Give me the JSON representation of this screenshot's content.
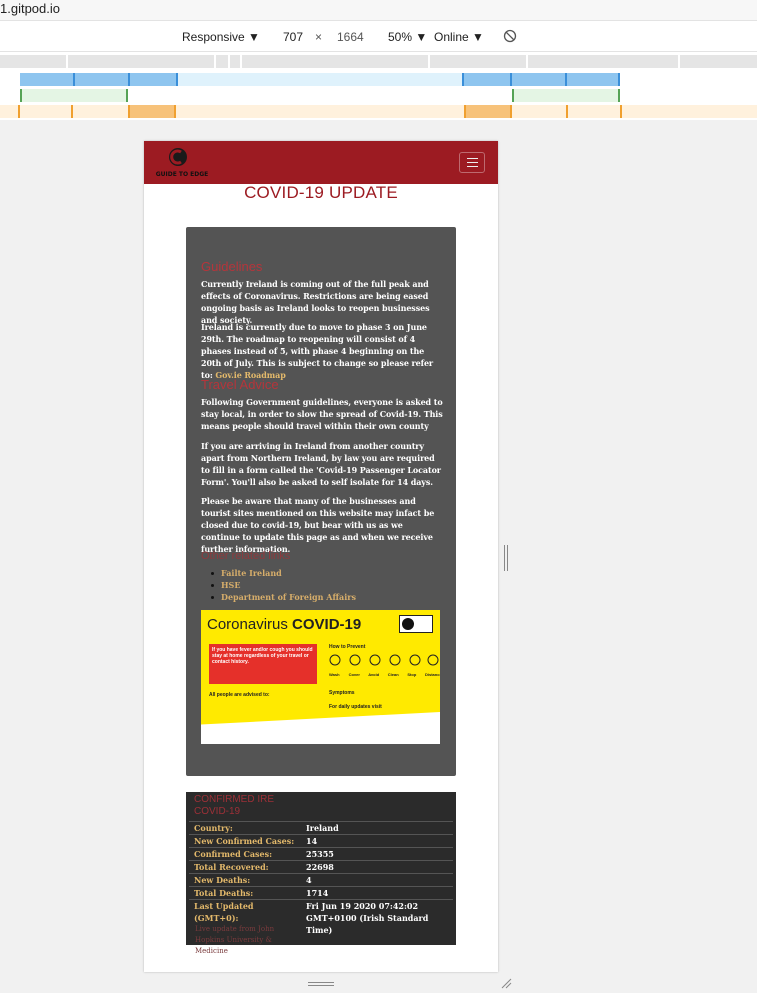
{
  "browser": {
    "url_partial": "1.gitpod.io"
  },
  "devtools": {
    "device": "Responsive",
    "width": "707",
    "times": "×",
    "height": "1664",
    "zoom": "50%",
    "network": "Online"
  },
  "site": {
    "logo_text": "GUIDE TO EDGE",
    "page_title": "COVID-19 UPDATE"
  },
  "guidelines": {
    "heading": "Guidelines",
    "p1": "Currently Ireland is coming out of the full peak and effects of Coronavirus. Restrictions are being eased ongoing basis as Ireland looks to reopen businesses and society.",
    "p2_text": "Ireland is currently due to move to phase 3 on June 29th. The roadmap to reopening will consist of 4 phases instead of 5, with phase 4 beginning on the 20th of July. This is subject to change so please refer to: ",
    "p2_link": "Gov.ie Roadmap"
  },
  "travel": {
    "heading": "Travel Advice",
    "p1": "Following Government guidelines, everyone is asked to stay local, in order to slow the spread of Covid-19. This means people should travel within their own county",
    "p2": "If you are arriving in Ireland from another country apart from Northern Ireland, by law you are required to fill in a form called the 'Covid-19 Passenger Locator Form'. You'll also be asked to self isolate for 14 days.",
    "p3": "Please be aware that many of the businesses and tourist sites mentioned on this website may infact be closed due to covid-19, but bear with us as we continue to update this page as and when we receive further information."
  },
  "links": {
    "heading": "Other related links",
    "items": [
      "Failte Ireland",
      "HSE",
      "Department of Foreign Affairs"
    ]
  },
  "poster": {
    "title_light": "Coronavirus",
    "title_bold": "COVID-19",
    "red_box": "If you have fever and/or cough you should stay at home regardless of your travel or contact history.",
    "how_to_prevent": "How to Prevent",
    "icons": [
      "Wash",
      "Cover",
      "Avoid",
      "Clean",
      "Stop",
      "Distance"
    ],
    "all_people": "All people are advised to:",
    "symptoms": "Symptoms",
    "daily_updates": "For daily updates visit"
  },
  "stats": {
    "heading": "CONFIRMED IRE COVID-19",
    "rows": [
      {
        "k": "Country:",
        "v": "Ireland"
      },
      {
        "k": "New Confirmed Cases:",
        "v": "14"
      },
      {
        "k": "Confirmed Cases:",
        "v": "25355"
      },
      {
        "k": "Total Recovered:",
        "v": "22698"
      },
      {
        "k": "New Deaths:",
        "v": "4"
      },
      {
        "k": "Total Deaths:",
        "v": "1714"
      },
      {
        "k": "Last Updated (GMT+0):",
        "v": "Fri Jun 19 2020 07:42:02 GMT+0100 (Irish Standard Time)"
      }
    ],
    "source": "Live update from John Hopkins University & Medicine"
  },
  "colors": {
    "brand": "#9c1b22",
    "card": "#545454",
    "accent": "#e3b96b"
  }
}
